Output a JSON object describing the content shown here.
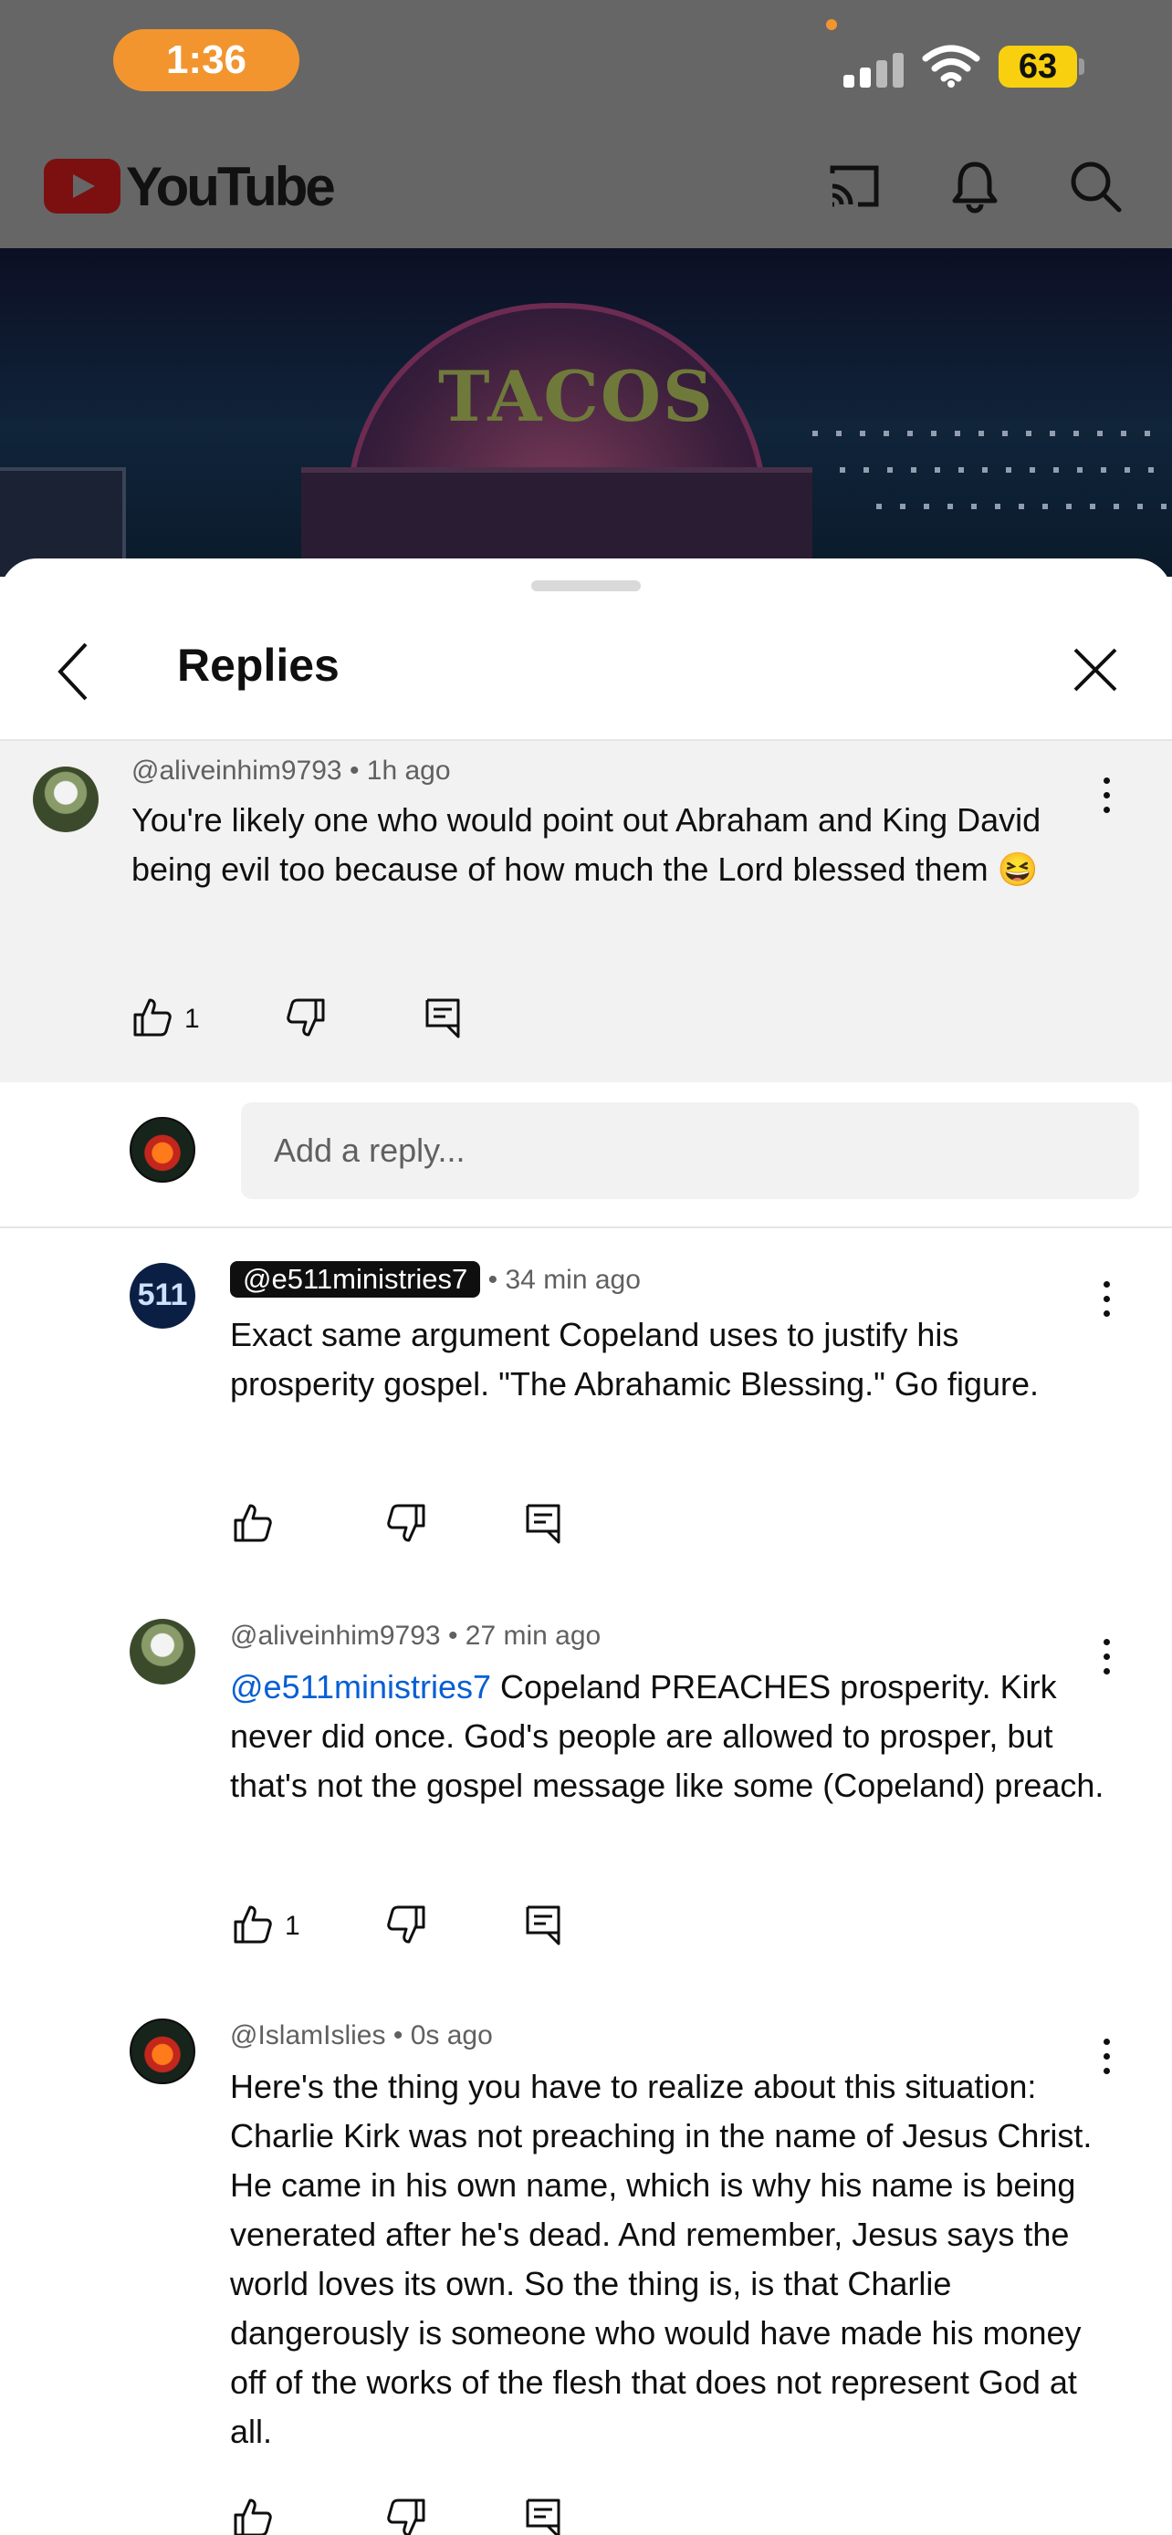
{
  "status_bar": {
    "time": "1:36",
    "battery": "63"
  },
  "header": {
    "logo_text": "YouTube",
    "icons": [
      "cast-icon",
      "bell-icon",
      "search-icon"
    ]
  },
  "video": {
    "sign_text": "TACOS"
  },
  "sheet": {
    "title": "Replies",
    "back_icon": "chevron-left-icon",
    "close_icon": "close-icon"
  },
  "parent_comment": {
    "author": "@aliveinhim9793",
    "time": "1h ago",
    "text": "You're likely one who would point out Abraham and King David being evil too because of how much the Lord blessed them 😆",
    "likes": "1"
  },
  "reply_box": {
    "placeholder": "Add a reply..."
  },
  "replies": [
    {
      "author": "@e511ministries7",
      "time": "34 min ago",
      "text": "Exact same argument Copeland uses to justify his prosperity gospel. \"The Abrahamic Blessing.\" Go figure.",
      "likes": "",
      "avatar_text": "511"
    },
    {
      "author": "@aliveinhim9793",
      "time": "27 min ago",
      "mention": "@e511ministries7",
      "text": " Copeland PREACHES prosperity. Kirk never did once.  God's people are allowed to prosper, but that's not the gospel message like some (Copeland) preach.",
      "likes": "1"
    },
    {
      "author": "@IslamIslies",
      "time": "0s ago",
      "text": "Here's the thing you have to realize about this situation: Charlie Kirk was not preaching in the name of Jesus Christ. He came in his own name, which is why his name is being venerated after he's dead. And remember, Jesus says the world loves its own. So the thing is, is that Charlie dangerously is someone who would have made his money off of the works of the flesh that does not represent God at all.",
      "likes": ""
    }
  ],
  "separator": "•",
  "colors": {
    "time_pill": "#f2952f",
    "battery": "#f8d00f",
    "mention": "#065fd4",
    "meta": "#606060"
  }
}
